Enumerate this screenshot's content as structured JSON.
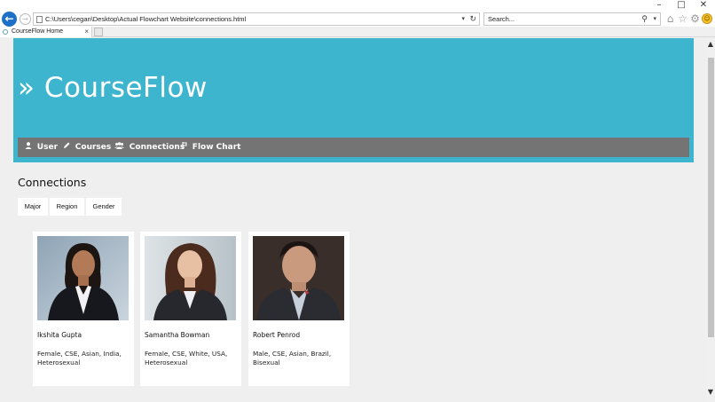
{
  "window": {
    "minimize_glyph": "–",
    "maximize_glyph": "□",
    "close_glyph": "✕"
  },
  "browser": {
    "address": "C:\\Users\\cegan\\Desktop\\Actual Flowchart Website\\connections.html",
    "search_placeholder": "Search...",
    "tab_title": "CourseFlow Home",
    "tab_close": "×",
    "icons": [
      "back-arrow-icon",
      "forward-arrow-icon",
      "refresh-icon",
      "search-icon",
      "home-icon",
      "star-icon",
      "gear-icon",
      "smiley-icon"
    ]
  },
  "site": {
    "title": "» CourseFlow",
    "brand_color": "#3db5cf",
    "nav_color": "#747474",
    "nav": [
      {
        "label": "User",
        "icon": "user-icon"
      },
      {
        "label": "Courses",
        "icon": "pencil-icon"
      },
      {
        "label": "Connections",
        "icon": "users-icon"
      },
      {
        "label": "Flow Chart",
        "icon": "flow-chart-icon"
      }
    ]
  },
  "main": {
    "title": "Connections",
    "filters": [
      "Major",
      "Region",
      "Gender"
    ],
    "people": [
      {
        "name": "Ikshita Gupta",
        "info": "Female, CSE, Asian, India, Heterosexual"
      },
      {
        "name": "Samantha Bowman",
        "info": "Female, CSE, White, USA, Heterosexual"
      },
      {
        "name": "Robert Penrod",
        "info": "Male, CSE, Asian, Brazil, Bisexual"
      }
    ]
  }
}
